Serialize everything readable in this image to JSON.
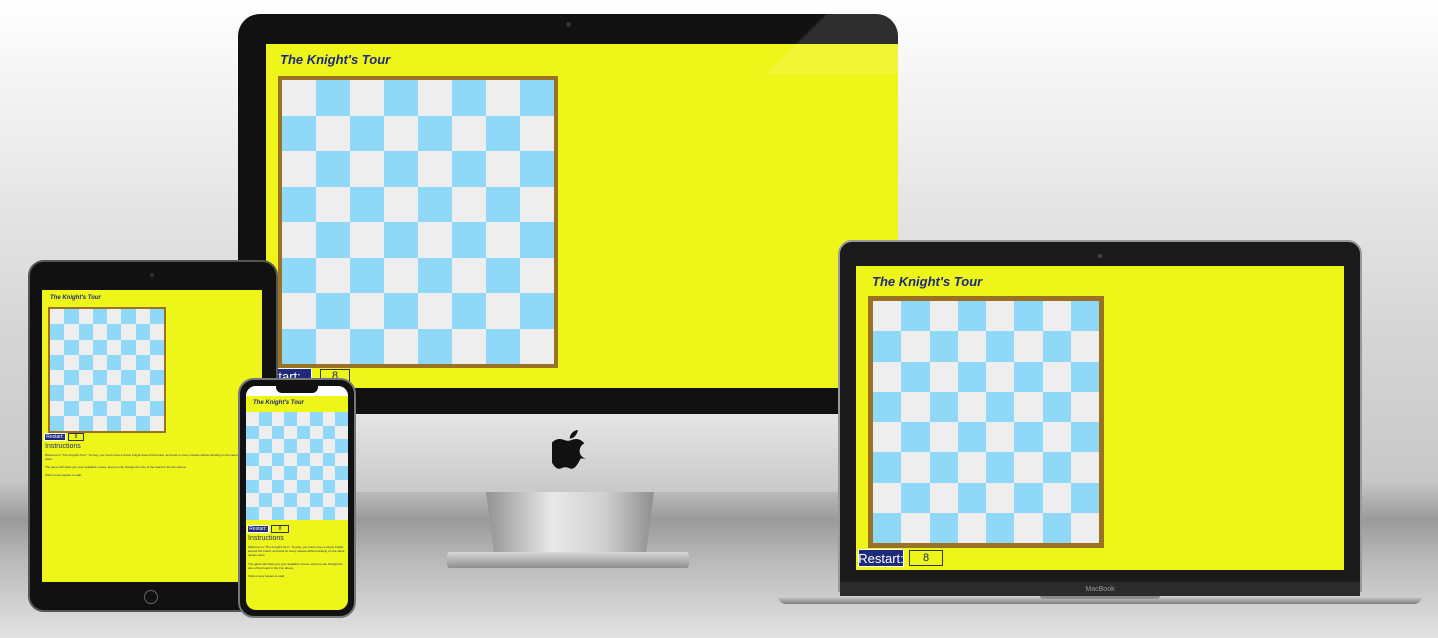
{
  "game": {
    "title": "The Knight's Tour",
    "restart_label": "Restart:",
    "board_size_value": "8",
    "instructions_heading": "Instructions",
    "instructions_p1": "Welcome to \"The Knight's Tour\". To play, you must move a chess Knight around the board, and land on every square without landing on the same square twice.",
    "instructions_p2": "The game will show you your available moves, and you can change the size of the board in the box above.",
    "instructions_p3": "Click on any square to start."
  },
  "devices": {
    "laptop_brand": "MacBook"
  },
  "colors": {
    "page_background": "#eef519",
    "title": "#1f2a7a",
    "board_frame": "#9b7123",
    "square_light": "#eeeeee",
    "square_dark": "#8fd8f8",
    "restart_background": "#1f2a7a"
  },
  "icons": [
    "apple-logo-icon"
  ]
}
